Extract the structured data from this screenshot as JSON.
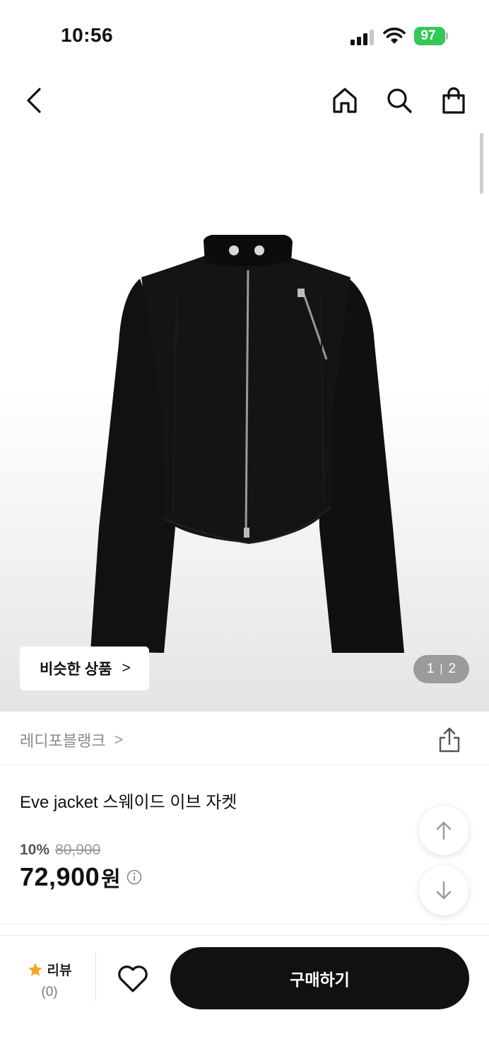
{
  "status_bar": {
    "time": "10:56",
    "battery": "97"
  },
  "nav": {
    "back_icon": "chevron-left-icon",
    "home_icon": "home-icon",
    "search_icon": "search-icon",
    "cart_icon": "shopping-bag-icon"
  },
  "gallery": {
    "similar_label": "비슷한 상품",
    "chevron": ">",
    "current": "1",
    "separator": "|",
    "total": "2"
  },
  "brand": {
    "name": "레디포블랭크",
    "chevron": ">"
  },
  "product": {
    "title": "Eve jacket 스웨이드 이브 자켓",
    "discount_rate": "10%",
    "original_price": "80,900",
    "sale_price": "72,900",
    "currency": "원"
  },
  "bottom_bar": {
    "review_label": "리뷰",
    "review_count": "(0)",
    "buy_label": "구매하기"
  },
  "colors": {
    "accent_star": "#f5a623",
    "battery_green": "#34c759",
    "button_black": "#111111"
  }
}
